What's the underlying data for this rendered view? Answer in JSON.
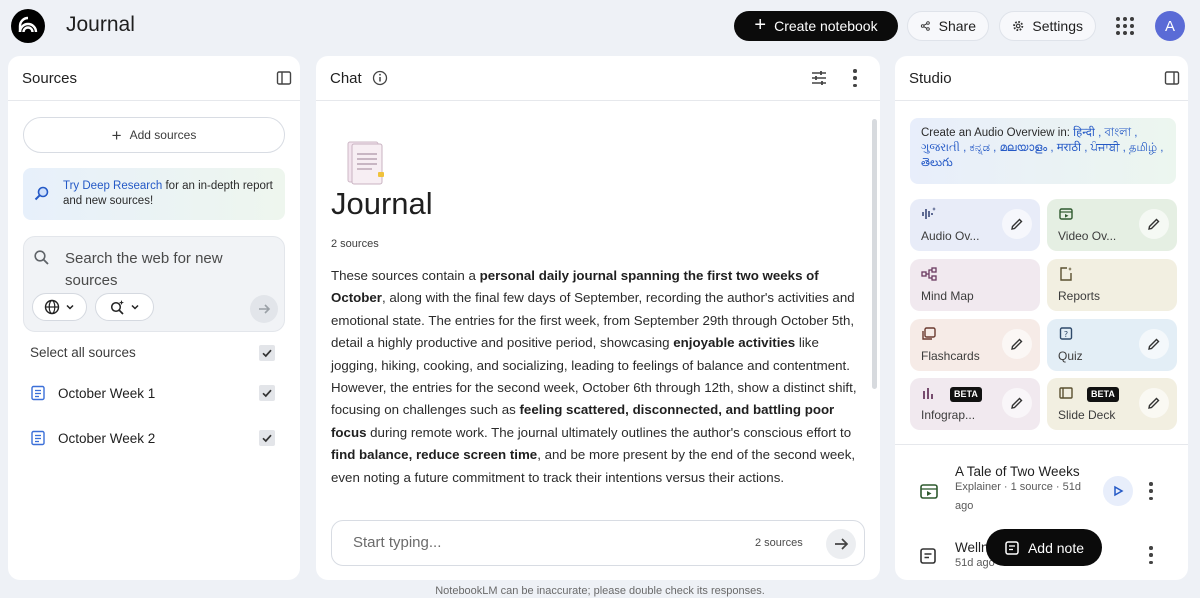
{
  "app": {
    "title": "Journal"
  },
  "header": {
    "create_label": "Create notebook",
    "share_label": "Share",
    "settings_label": "Settings",
    "avatar_initial": "A"
  },
  "sources": {
    "title": "Sources",
    "add_label": "Add sources",
    "deep_research_link": "Try Deep Research",
    "deep_research_text": "for an in-depth report and new sources!",
    "search_placeholder": "Search the web for new sources",
    "select_all_label": "Select all sources",
    "items": [
      {
        "label": "October Week 1",
        "checked": true
      },
      {
        "label": "October Week 2",
        "checked": true
      }
    ]
  },
  "chat": {
    "title": "Chat",
    "notebook_title": "Journal",
    "source_count": "2 sources",
    "summary": [
      {
        "t": "These sources contain a ",
        "b": false
      },
      {
        "t": "personal daily journal spanning the first two weeks of October",
        "b": true
      },
      {
        "t": ", along with the final few days of September, recording the author's activities and emotional state. The entries for the first week, from September 29th through October 5th, detail a highly productive and positive period, showcasing ",
        "b": false
      },
      {
        "t": "enjoyable activities",
        "b": true
      },
      {
        "t": " like jogging, hiking, cooking, and socializing, leading to feelings of balance and contentment. However, the entries for the second week, October 6th through 12th, show a distinct shift, focusing on challenges such as ",
        "b": false
      },
      {
        "t": "feeling scattered, disconnected, and battling poor focus",
        "b": true
      },
      {
        "t": " during remote work. The journal ultimately outlines the author's conscious effort to ",
        "b": false
      },
      {
        "t": "find balance, reduce screen time",
        "b": true
      },
      {
        "t": ", and be more present by the end of the second week, even noting a future commitment to track their intentions versus their actions.",
        "b": false
      }
    ],
    "input_placeholder": "Start typing...",
    "input_source_count": "2 sources"
  },
  "studio": {
    "title": "Studio",
    "audio_banner_prefix": "Create an Audio Overview in:",
    "languages": "हिन्दी , বাংলা , ગુજરાતી , ಕನ್ನಡ , മലയാളം , मराठी , ਪੰਜਾਬੀ , தமிழ் , తెలుగు",
    "tiles": [
      {
        "label": "Audio Ov...",
        "icon": "audio-waveform-icon",
        "color": "#e8ecf8"
      },
      {
        "label": "Video Ov...",
        "icon": "video-icon",
        "color": "#e5efe3"
      },
      {
        "label": "Mind Map",
        "icon": "mind-map-icon",
        "color": "#f1e9ef"
      },
      {
        "label": "Reports",
        "icon": "reports-icon",
        "color": "#f2efe1"
      },
      {
        "label": "Flashcards",
        "icon": "flashcards-icon",
        "color": "#f6ebe7"
      },
      {
        "label": "Quiz",
        "icon": "quiz-icon",
        "color": "#e3eef6"
      },
      {
        "label": "Infograp...",
        "icon": "infographic-icon",
        "color": "#f1e9ef",
        "badge": "BETA"
      },
      {
        "label": "Slide Deck",
        "icon": "slide-deck-icon",
        "color": "#f2efe1",
        "badge": "BETA"
      }
    ],
    "notes": [
      {
        "title": "A Tale of Two Weeks",
        "meta": "Explainer · 1 source · 51d ago"
      },
      {
        "title": "Welln",
        "meta": "51d ago"
      }
    ],
    "add_note_label": "Add note"
  },
  "footer": {
    "disclaimer": "NotebookLM can be inaccurate; please double check its responses."
  },
  "colors": {
    "accent_black": "#0b0b0b",
    "link_blue": "#2459c6",
    "avatar": "#5a6bd6"
  }
}
